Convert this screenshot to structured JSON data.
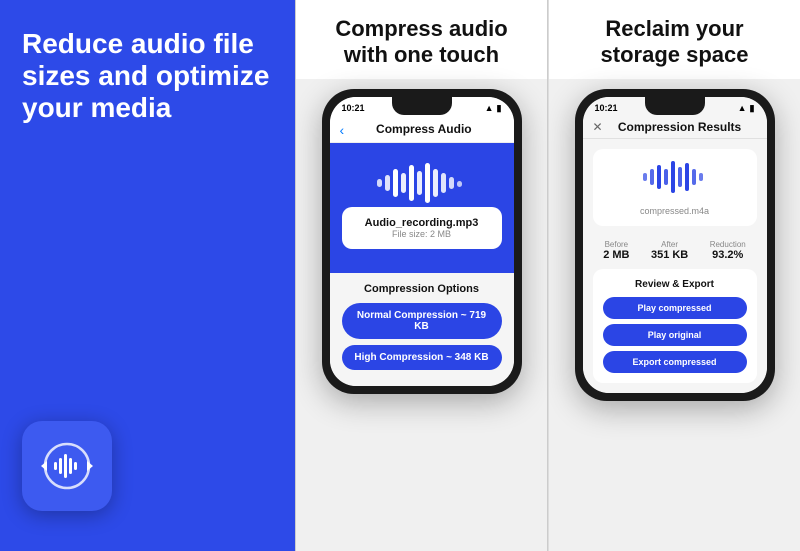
{
  "panel1": {
    "headline": "Reduce audio file sizes and optimize your media",
    "background_color": "#2B45E5"
  },
  "panel2": {
    "header_headline": "Compress audio with one touch",
    "phone": {
      "status_time": "10:21",
      "screen_title": "Compress Audio",
      "back_label": "‹",
      "file_name": "Audio_recording.mp3",
      "file_size_label": "File size: 2 MB",
      "compression_section_title": "Compression Options",
      "option1_label": "Normal Compression ~ 719 KB",
      "option2_label": "High Compression ~ 348 KB"
    }
  },
  "panel3": {
    "header_headline": "Reclaim your storage space",
    "phone": {
      "status_time": "10:21",
      "screen_title": "Compression Results",
      "close_label": "✕",
      "compressed_file_name": "compressed.m4a",
      "before_label": "Before",
      "before_value": "2 MB",
      "after_label": "After",
      "after_value": "351 KB",
      "reduction_label": "Reduction",
      "reduction_value": "93.2%",
      "review_section_title": "Review & Export",
      "btn1_label": "Play compressed",
      "btn2_label": "Play original",
      "btn3_label": "Export compressed"
    }
  }
}
